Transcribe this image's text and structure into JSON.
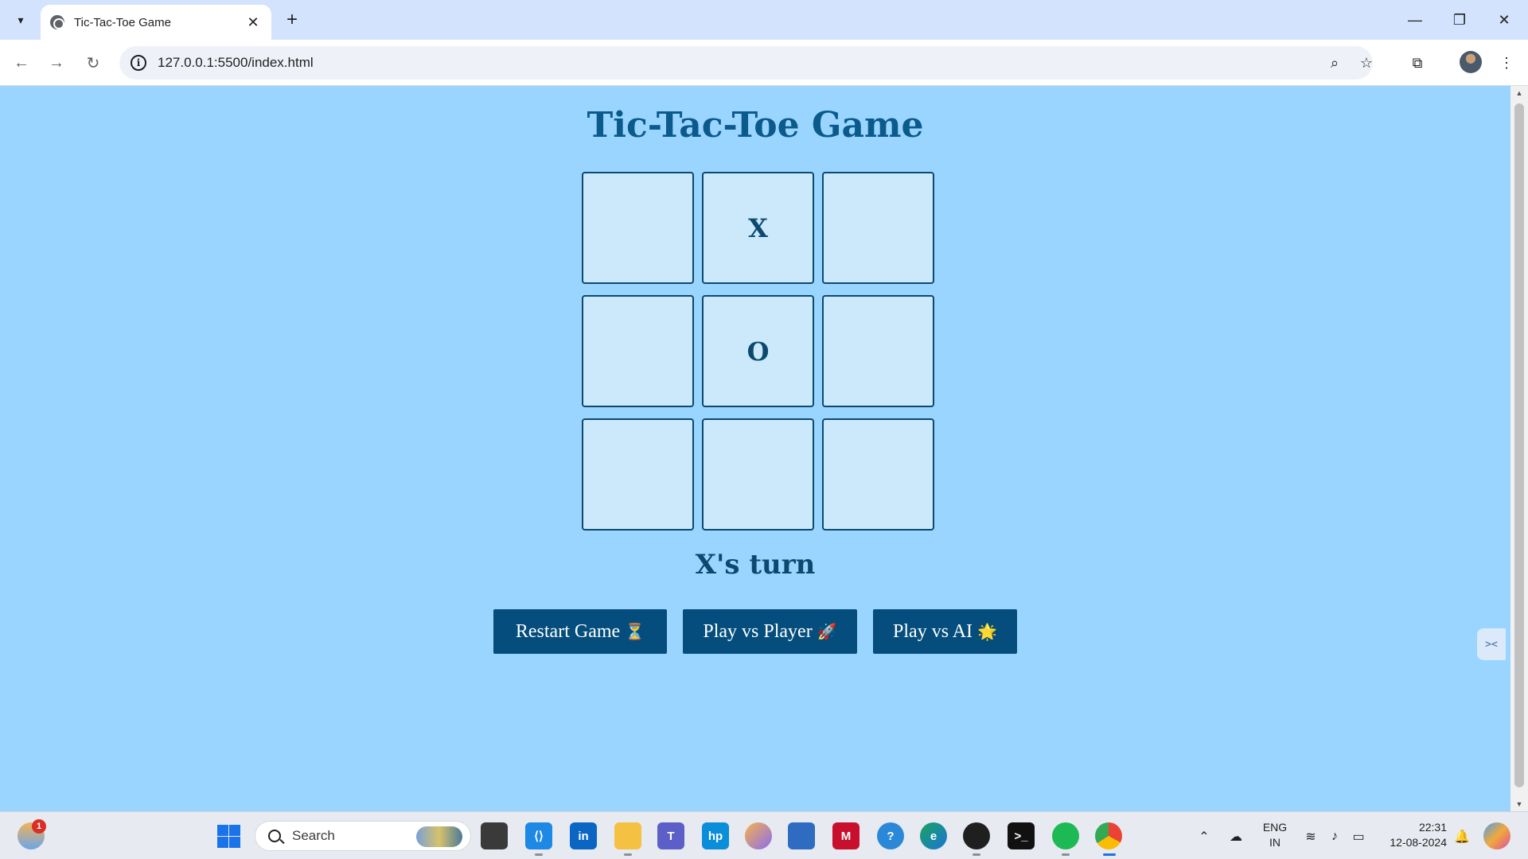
{
  "browser": {
    "tab_title": "Tic-Tac-Toe Game",
    "url": "127.0.0.1:5500/index.html"
  },
  "game": {
    "title": "Tic-Tac-Toe Game",
    "cells": [
      "",
      "X",
      "",
      "",
      "O",
      "",
      "",
      "",
      ""
    ],
    "status": "X's turn",
    "buttons": {
      "restart": "Restart Game",
      "restart_emoji": "⏳",
      "pvp": "Play vs Player",
      "pvp_emoji": "🚀",
      "ai": "Play vs AI",
      "ai_emoji": "🌟"
    }
  },
  "colors": {
    "page_background": "#9ad5ff",
    "title": "#0a5a8c",
    "cell_background": "#cce9fc",
    "cell_border": "#0b4a6e",
    "button_background": "#044d7c"
  },
  "taskbar": {
    "weather_badge": "1",
    "search_label": "Search",
    "language": "ENG",
    "region": "IN",
    "time": "22:31",
    "date": "12-08-2024"
  }
}
